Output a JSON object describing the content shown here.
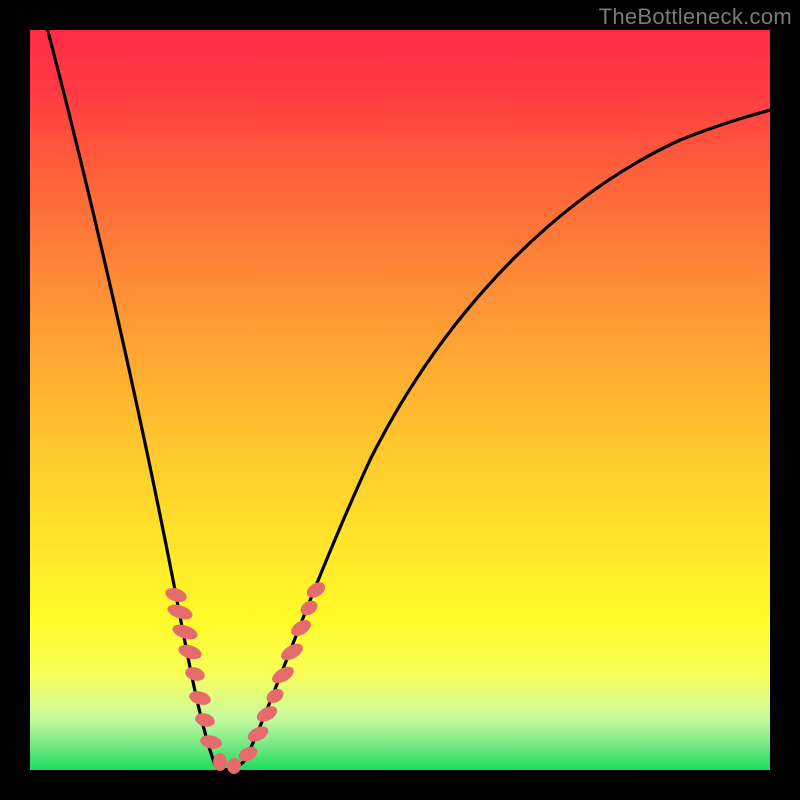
{
  "watermark": "TheBottleneck.com",
  "colors": {
    "frame": "#000000",
    "curve": "#000000",
    "markers": "#e66c6c",
    "gradient_top": "#ff2c47",
    "gradient_bottom": "#1adf5e"
  },
  "chart_data": {
    "type": "line",
    "title": "",
    "xlabel": "",
    "ylabel": "",
    "xlim": [
      0,
      100
    ],
    "ylim": [
      0,
      100
    ],
    "grid": false,
    "legend": false,
    "description": "V-shaped bottleneck curve. The y-axis represents bottleneck percentage (0 = no bottleneck / green at bottom, 100 = severe bottleneck / red at top). Minimum (optimal match) is near x ≈ 25 where the curve touches y ≈ 0. Left branch is very steep; right branch rises more gradually and asymptotes toward the top-right.",
    "series": [
      {
        "name": "bottleneck-curve",
        "x": [
          2,
          5,
          8,
          11,
          14,
          17,
          20,
          22,
          24,
          25,
          26,
          28,
          30,
          34,
          38,
          44,
          50,
          58,
          66,
          76,
          86,
          96,
          100
        ],
        "y": [
          100,
          86,
          72,
          58,
          45,
          33,
          21,
          12,
          4,
          0,
          2,
          7,
          13,
          24,
          33,
          44,
          53,
          62,
          69,
          76,
          81,
          85,
          86
        ]
      },
      {
        "name": "marker-cluster",
        "type": "scatter",
        "x": [
          19,
          19.6,
          20.2,
          20.9,
          21.5,
          22.2,
          22.8,
          23.6,
          24.4,
          25.2,
          26,
          26.9,
          27.8,
          28.8,
          29.7,
          30.6,
          31.5,
          32.5,
          33.5,
          34.5
        ],
        "y": [
          23,
          20,
          17,
          14.5,
          12,
          9.5,
          7.5,
          5,
          3,
          1.5,
          1,
          2,
          4,
          6.5,
          9,
          12,
          15,
          18,
          21,
          24
        ]
      }
    ]
  }
}
